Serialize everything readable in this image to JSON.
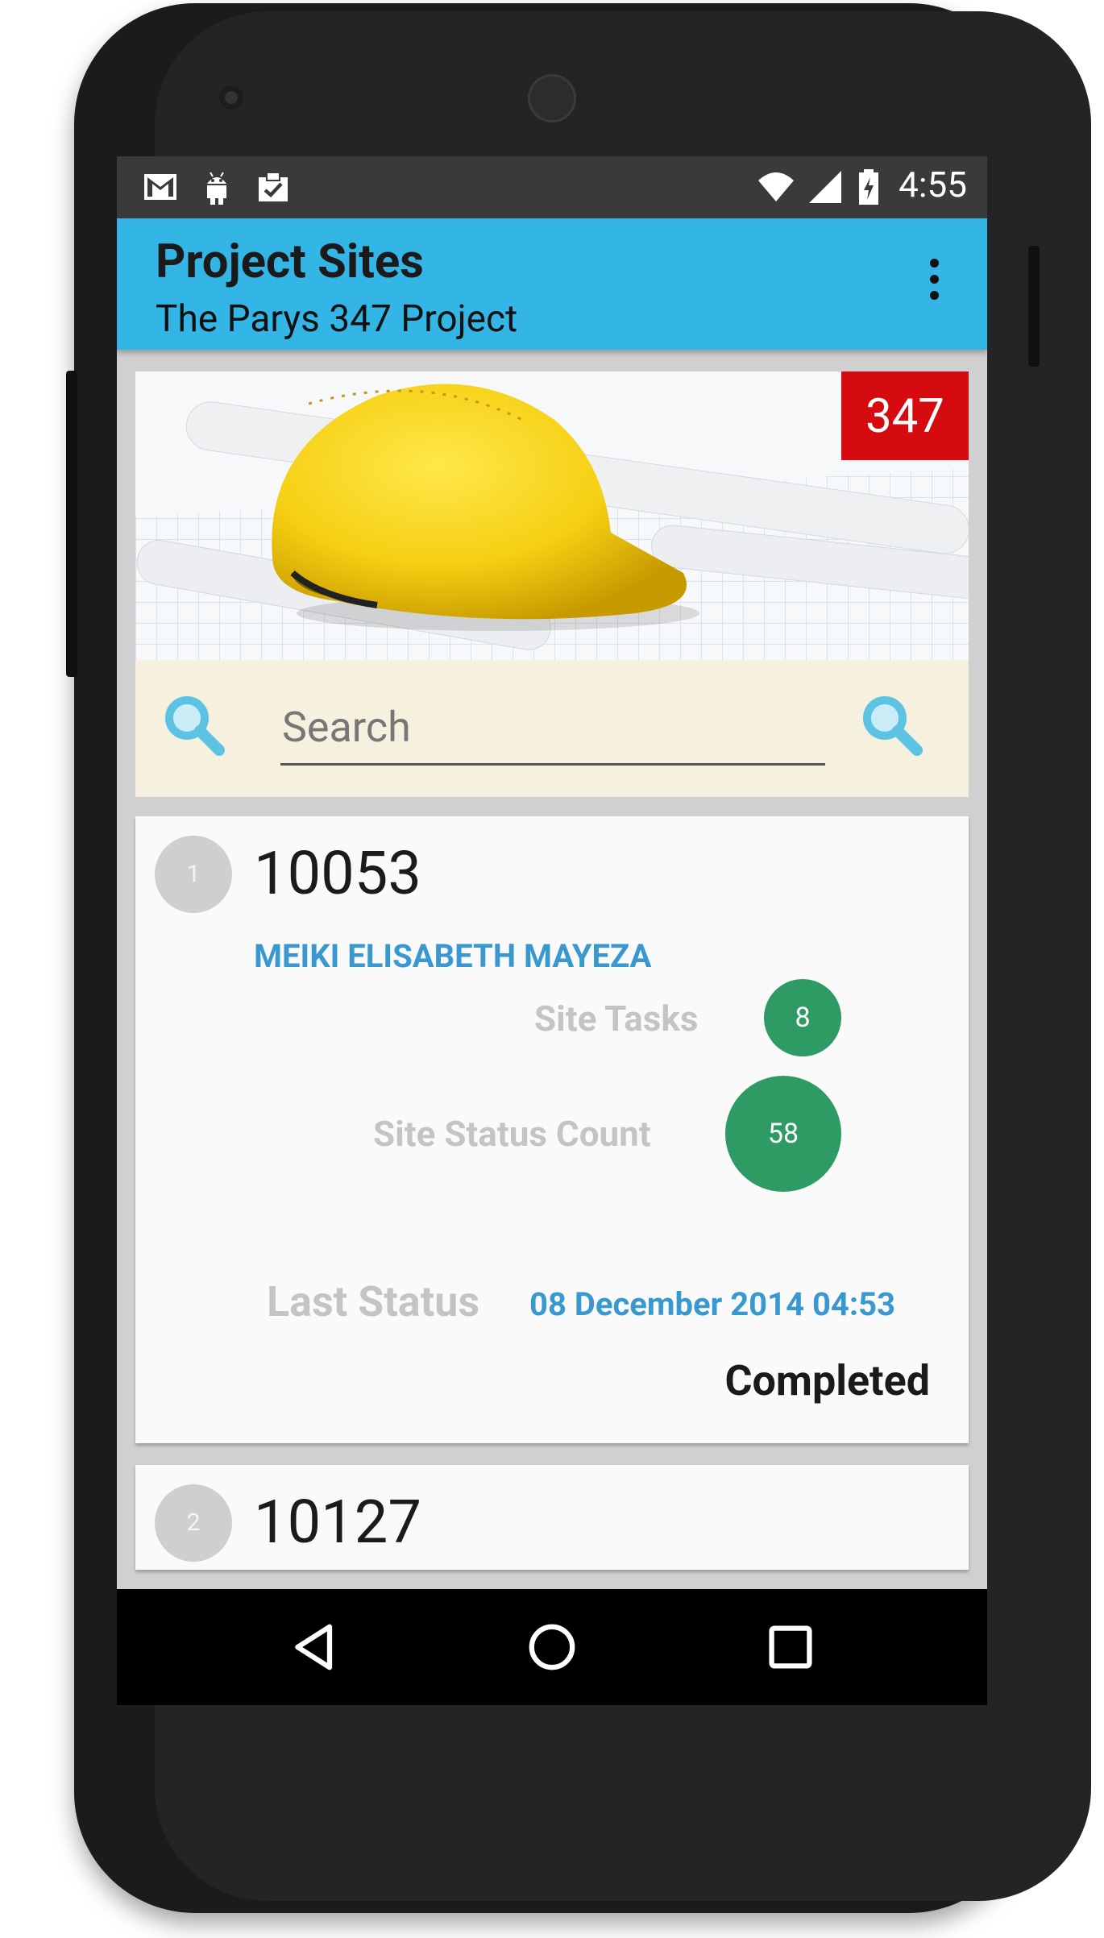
{
  "status_bar": {
    "time": "4:55",
    "left_icons": [
      "gmail-icon",
      "android-icon",
      "clipboard-check-icon"
    ],
    "right_icons": [
      "wifi-icon",
      "cell-signal-icon",
      "battery-charging-icon"
    ]
  },
  "app_bar": {
    "title": "Project Sites",
    "subtitle": "The Parys 347 Project"
  },
  "hero": {
    "badge": "347"
  },
  "search": {
    "placeholder": "Search"
  },
  "sites": [
    {
      "index": "1",
      "number": "10053",
      "owner": "MEIKI ELISABETH MAYEZA",
      "tasks_label": "Site Tasks",
      "tasks_count": "8",
      "status_count_label": "Site Status Count",
      "status_count": "58",
      "last_status_label": "Last Status",
      "last_status_date": "08 December 2014 04:53",
      "status": "Completed"
    },
    {
      "index": "2",
      "number": "10127"
    }
  ],
  "colors": {
    "app_bar": "#33b5e5",
    "badge": "#d50b10",
    "accent_blue": "#3a98d0",
    "green": "#2e9a64",
    "search_bg": "#f6f0de"
  }
}
